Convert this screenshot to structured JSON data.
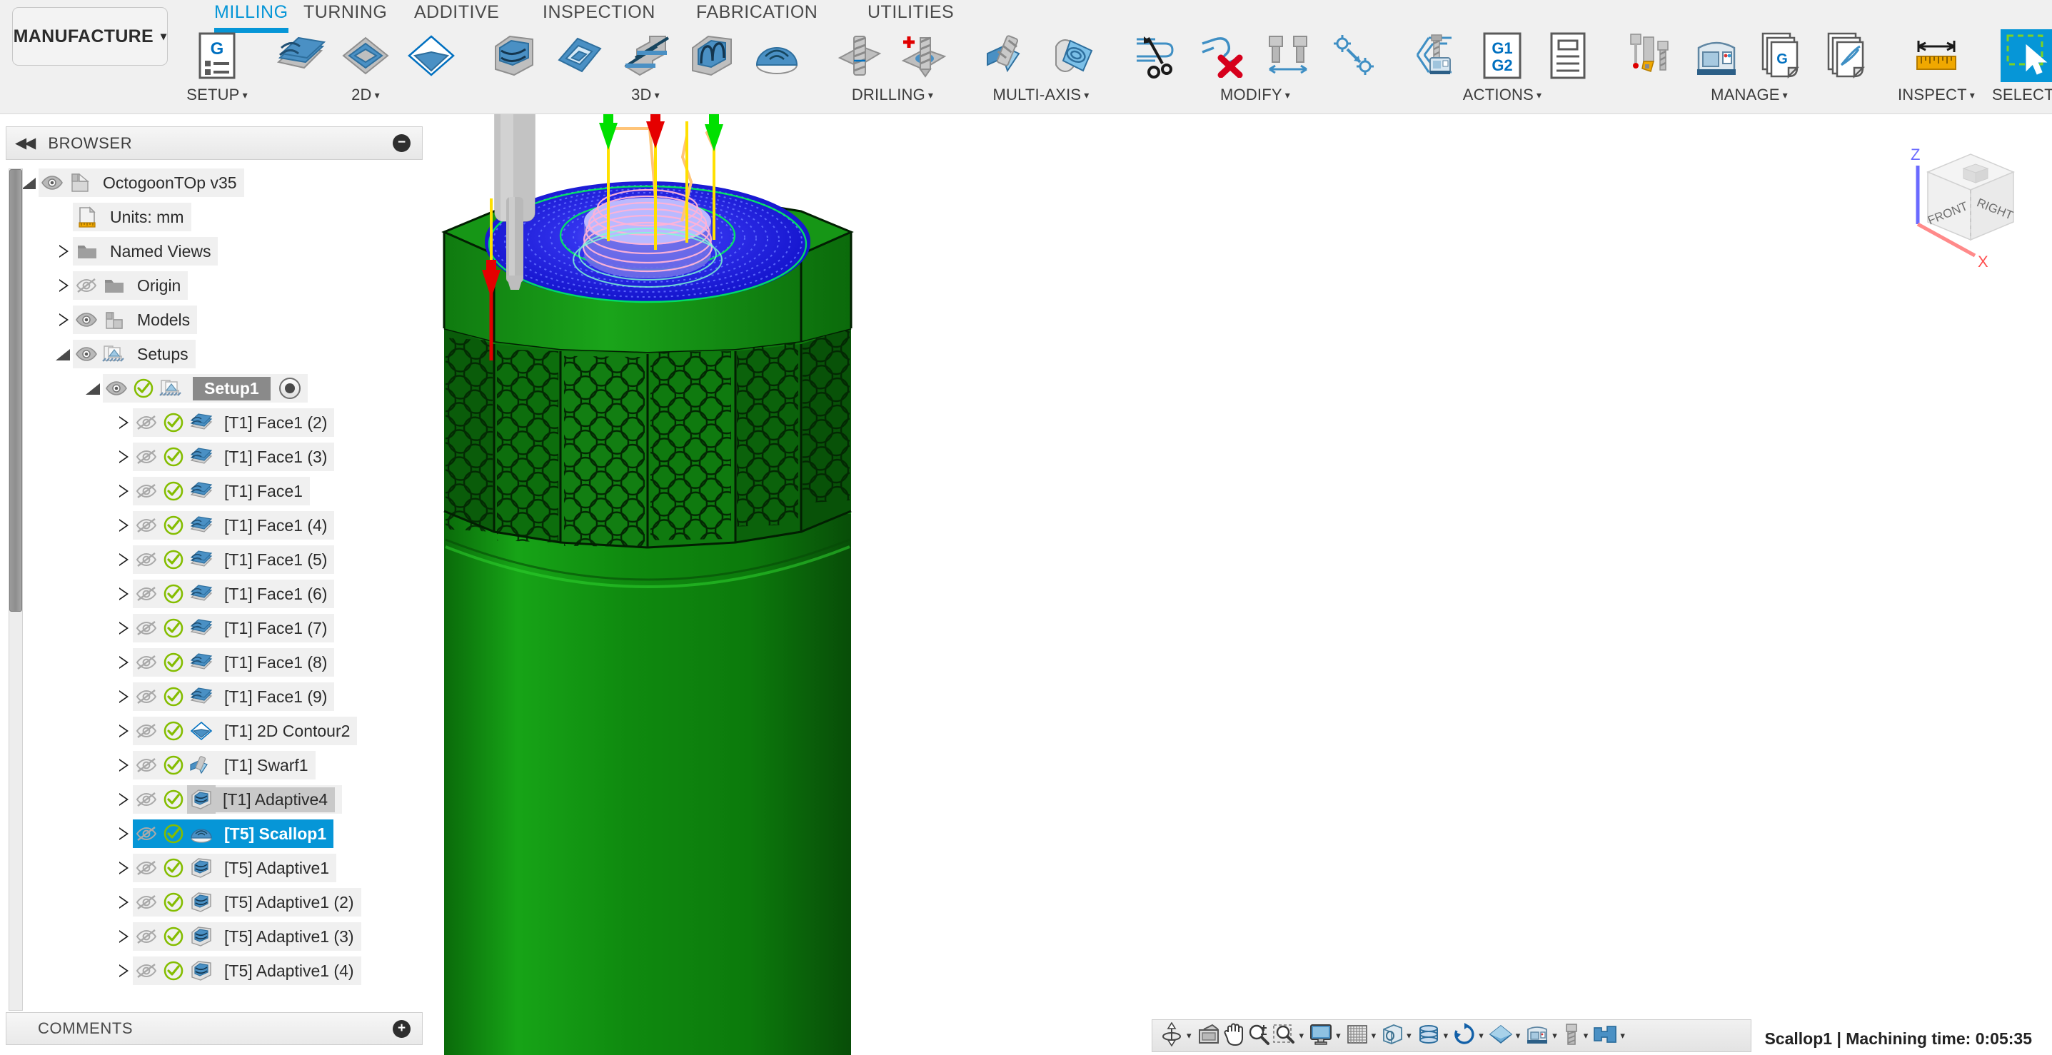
{
  "app": {
    "workspace_button": "MANUFACTURE",
    "workspace_caret": "▾"
  },
  "tabs": [
    {
      "label": "MILLING",
      "active": true
    },
    {
      "label": "TURNING",
      "active": false
    },
    {
      "label": "ADDITIVE",
      "active": false
    },
    {
      "label": "INSPECTION",
      "active": false
    },
    {
      "label": "FABRICATION",
      "active": false
    },
    {
      "label": "UTILITIES",
      "active": false
    }
  ],
  "ribbon_panels": [
    {
      "label": "SETUP",
      "caret": "▾",
      "buttons": [
        {
          "icon": "setup-g-icon",
          "name": "setup"
        }
      ]
    },
    {
      "label": "2D",
      "caret": "▾",
      "buttons": [
        {
          "icon": "face-icon",
          "name": "face"
        },
        {
          "icon": "pocket-2d-icon",
          "name": "pocket-2d"
        },
        {
          "icon": "contour-2d-icon",
          "name": "contour-2d"
        }
      ]
    },
    {
      "label": "3D",
      "caret": "▾",
      "buttons": [
        {
          "icon": "adaptive-clearing-icon",
          "name": "adaptive-clearing"
        },
        {
          "icon": "pocket-clearing-icon",
          "name": "pocket-clearing"
        },
        {
          "icon": "horizontal-icon",
          "name": "horizontal"
        },
        {
          "icon": "parallel-icon",
          "name": "parallel"
        },
        {
          "icon": "scallop-icon",
          "name": "scallop"
        }
      ]
    },
    {
      "label": "DRILLING",
      "caret": "▾",
      "buttons": [
        {
          "icon": "drill-icon",
          "name": "drill"
        },
        {
          "icon": "bore-icon",
          "name": "bore"
        }
      ]
    },
    {
      "label": "MULTI-AXIS",
      "caret": "▾",
      "buttons": [
        {
          "icon": "swarf-icon",
          "name": "swarf"
        },
        {
          "icon": "multi-axis-contour-icon",
          "name": "multi-axis-contour"
        }
      ]
    },
    {
      "label": "MODIFY",
      "caret": "▾",
      "buttons": [
        {
          "icon": "scissors-icon",
          "name": "trim-toolpath"
        },
        {
          "icon": "delete-toolpath-icon",
          "name": "delete-toolpath"
        },
        {
          "icon": "tool-compare-icon",
          "name": "tool-compare"
        },
        {
          "icon": "transform-icon",
          "name": "transform"
        }
      ]
    },
    {
      "label": "ACTIONS",
      "caret": "▾",
      "buttons": [
        {
          "icon": "simulate-icon",
          "name": "simulate"
        },
        {
          "icon": "g1-g2-icon",
          "name": "post-process"
        },
        {
          "icon": "setup-sheet-icon",
          "name": "setup-sheet"
        }
      ]
    },
    {
      "label": "MANAGE",
      "caret": "▾",
      "buttons": [
        {
          "icon": "tool-library-icon",
          "name": "tool-library"
        },
        {
          "icon": "machine-library-icon",
          "name": "machine-library"
        },
        {
          "icon": "post-library-icon",
          "name": "post-library"
        },
        {
          "icon": "template-library-icon",
          "name": "template-library"
        }
      ]
    },
    {
      "label": "INSPECT",
      "caret": "▾",
      "buttons": [
        {
          "icon": "measure-icon",
          "name": "measure"
        }
      ]
    },
    {
      "label": "SELECT",
      "caret": "▾",
      "buttons": [
        {
          "icon": "select-window-icon",
          "name": "select"
        }
      ]
    }
  ],
  "browser": {
    "title": "BROWSER",
    "collapse_icon": "◀◀",
    "minimize_icon": "−",
    "tree": [
      {
        "label": "OctogoonTOp v35",
        "indent": 0,
        "twisty": "open",
        "eye": "visible",
        "icon": "document-icon",
        "check": false
      },
      {
        "label": "Units: mm",
        "indent": 1,
        "twisty": "none",
        "eye": "none",
        "icon": "units-icon",
        "check": false
      },
      {
        "label": "Named Views",
        "indent": 1,
        "twisty": "closed",
        "eye": "none",
        "icon": "folder-icon",
        "check": false
      },
      {
        "label": "Origin",
        "indent": 1,
        "twisty": "closed",
        "eye": "hidden",
        "icon": "folder-icon",
        "check": false
      },
      {
        "label": "Models",
        "indent": 1,
        "twisty": "closed",
        "eye": "visible",
        "icon": "models-icon",
        "check": false
      },
      {
        "label": "Setups",
        "indent": 1,
        "twisty": "open",
        "eye": "visible",
        "icon": "setup-folder-icon",
        "check": false
      },
      {
        "label": "Setup1",
        "indent": 2,
        "twisty": "open",
        "eye": "visible",
        "icon": "setup-folder-icon",
        "check": true,
        "style": "setup",
        "active_dot": true
      },
      {
        "label": "[T1] Face1 (2)",
        "indent": 3,
        "twisty": "closed",
        "eye": "hidden",
        "icon": "face-op-icon",
        "check": true
      },
      {
        "label": "[T1] Face1 (3)",
        "indent": 3,
        "twisty": "closed",
        "eye": "hidden",
        "icon": "face-op-icon",
        "check": true
      },
      {
        "label": "[T1] Face1",
        "indent": 3,
        "twisty": "closed",
        "eye": "hidden",
        "icon": "face-op-icon",
        "check": true
      },
      {
        "label": "[T1] Face1 (4)",
        "indent": 3,
        "twisty": "closed",
        "eye": "hidden",
        "icon": "face-op-icon",
        "check": true
      },
      {
        "label": "[T1] Face1 (5)",
        "indent": 3,
        "twisty": "closed",
        "eye": "hidden",
        "icon": "face-op-icon",
        "check": true
      },
      {
        "label": "[T1] Face1 (6)",
        "indent": 3,
        "twisty": "closed",
        "eye": "hidden",
        "icon": "face-op-icon",
        "check": true
      },
      {
        "label": "[T1] Face1 (7)",
        "indent": 3,
        "twisty": "closed",
        "eye": "hidden",
        "icon": "face-op-icon",
        "check": true
      },
      {
        "label": "[T1] Face1 (8)",
        "indent": 3,
        "twisty": "closed",
        "eye": "hidden",
        "icon": "face-op-icon",
        "check": true
      },
      {
        "label": "[T1] Face1 (9)",
        "indent": 3,
        "twisty": "closed",
        "eye": "hidden",
        "icon": "face-op-icon",
        "check": true
      },
      {
        "label": "[T1] 2D Contour2",
        "indent": 3,
        "twisty": "closed",
        "eye": "hidden",
        "icon": "contour-op-icon",
        "check": true
      },
      {
        "label": "[T1] Swarf1",
        "indent": 3,
        "twisty": "closed",
        "eye": "hidden",
        "icon": "swarf-op-icon",
        "check": true
      },
      {
        "label": "[T1] Adaptive4",
        "indent": 3,
        "twisty": "closed",
        "eye": "hidden",
        "icon": "adaptive-op-icon",
        "check": true,
        "style": "gray"
      },
      {
        "label": "[T5] Scallop1",
        "indent": 3,
        "twisty": "closed",
        "eye": "hidden",
        "icon": "scallop-op-icon",
        "check": true,
        "style": "selected"
      },
      {
        "label": "[T5] Adaptive1",
        "indent": 3,
        "twisty": "closed",
        "eye": "hidden",
        "icon": "adaptive-op-icon",
        "check": true
      },
      {
        "label": "[T5] Adaptive1 (2)",
        "indent": 3,
        "twisty": "closed",
        "eye": "hidden",
        "icon": "adaptive-op-icon",
        "check": true
      },
      {
        "label": "[T5] Adaptive1 (3)",
        "indent": 3,
        "twisty": "closed",
        "eye": "hidden",
        "icon": "adaptive-op-icon",
        "check": true
      },
      {
        "label": "[T5] Adaptive1 (4)",
        "indent": 3,
        "twisty": "closed",
        "eye": "hidden",
        "icon": "adaptive-op-icon",
        "check": true
      }
    ]
  },
  "comments": {
    "title": "COMMENTS",
    "add_icon": "+"
  },
  "viewcube": {
    "front_face": "FRONT",
    "right_face": "RIGHT",
    "axis_z": "Z",
    "axis_x": "X"
  },
  "navbar": [
    {
      "name": "orbit-icon",
      "caret": true
    },
    {
      "name": "look-at-icon",
      "caret": false
    },
    {
      "name": "pan-icon",
      "caret": false
    },
    {
      "name": "zoom-icon",
      "caret": false
    },
    {
      "name": "zoom-window-icon",
      "caret": true
    },
    {
      "name": "display-settings-icon",
      "caret": true
    },
    {
      "name": "grid-snaps-icon",
      "caret": true
    },
    {
      "name": "viewports-icon",
      "caret": true
    },
    {
      "name": "toolpath-display-icon",
      "caret": true
    },
    {
      "name": "simulation-icon",
      "caret": true
    },
    {
      "name": "stock-visibility-icon",
      "caret": true
    },
    {
      "name": "machine-display-icon",
      "caret": true
    },
    {
      "name": "tool-display-icon",
      "caret": true
    },
    {
      "name": "fixture-display-icon",
      "caret": true
    }
  ],
  "status": {
    "text": "Scallop1 | Machining time: 0:05:35"
  },
  "colors": {
    "accent": "#0696d7",
    "panel_bg": "#f0f0f0",
    "check_green": "#7ab800",
    "selection_blue": "#0696d7",
    "model_green": "#149414",
    "toolpath_blue": "#1b1be6",
    "lead_red": "#e00000",
    "lead_green": "#00d000"
  }
}
